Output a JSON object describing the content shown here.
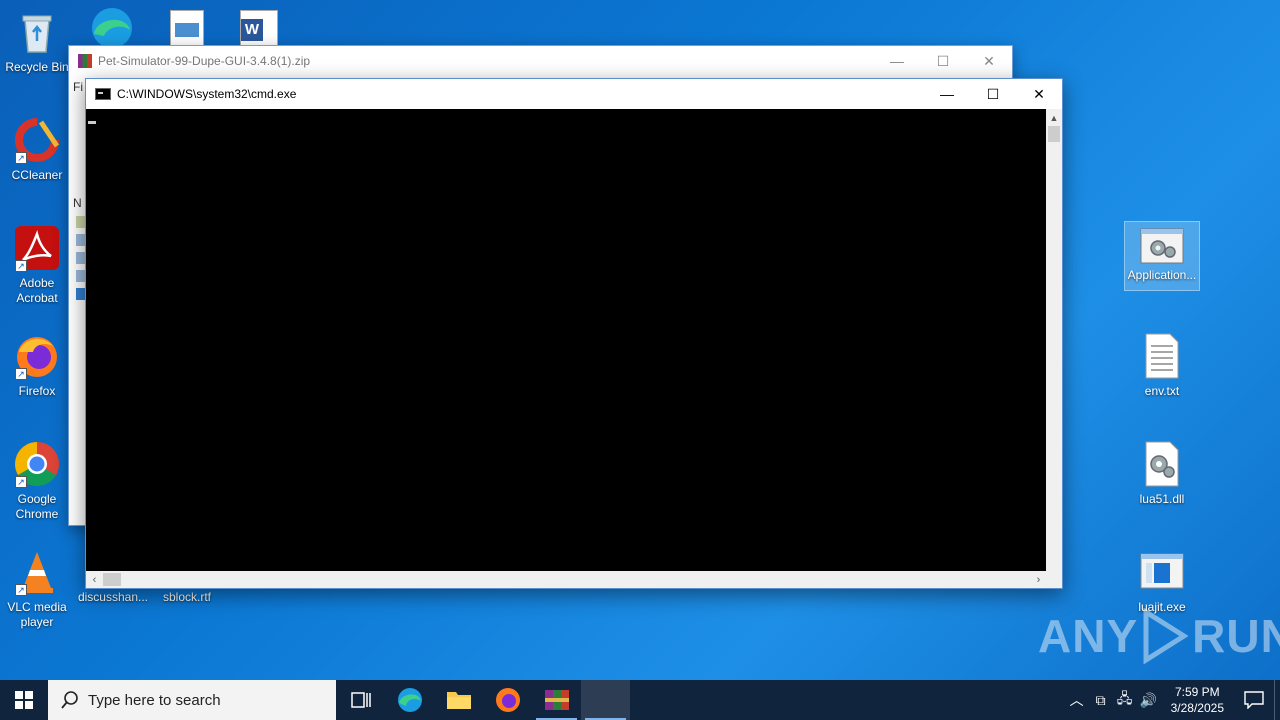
{
  "desktop": {
    "icons_left": [
      {
        "label": "Recycle Bin",
        "icon": "recycle-bin-icon"
      },
      {
        "label": "CCleaner",
        "icon": "ccleaner-icon"
      },
      {
        "label": "Adobe Acrobat",
        "icon": "acrobat-icon"
      },
      {
        "label": "Firefox",
        "icon": "firefox-icon"
      },
      {
        "label": "Google Chrome",
        "icon": "chrome-icon"
      },
      {
        "label": "VLC media player",
        "icon": "vlc-icon"
      }
    ],
    "icons_bottom": [
      {
        "label": "discusshan...",
        "icon": "file-icon"
      },
      {
        "label": "sblock.rtf",
        "icon": "rtf-icon"
      }
    ],
    "icons_right": [
      {
        "label": "Application...",
        "icon": "application-gear-icon",
        "selected": true
      },
      {
        "label": "env.txt",
        "icon": "text-file-icon"
      },
      {
        "label": "lua51.dll",
        "icon": "dll-gear-icon"
      },
      {
        "label": "luajit.exe",
        "icon": "exe-window-icon"
      }
    ]
  },
  "winrar_window": {
    "title": "Pet-Simulator-99-Dupe-GUI-3.4.8(1).zip",
    "menu_fragment": "Fi",
    "column_fragment": "N"
  },
  "cmd_window": {
    "title": "C:\\WINDOWS\\system32\\cmd.exe",
    "console_text": ""
  },
  "watermark": {
    "left": "ANY",
    "right": "RUN"
  },
  "taskbar": {
    "search_placeholder": "Type here to search",
    "time": "7:59 PM",
    "date": "3/28/2025"
  },
  "colors": {
    "desktop_bg": "#0b78d4",
    "taskbar_bg": "#10243d",
    "console_bg": "#000000"
  }
}
